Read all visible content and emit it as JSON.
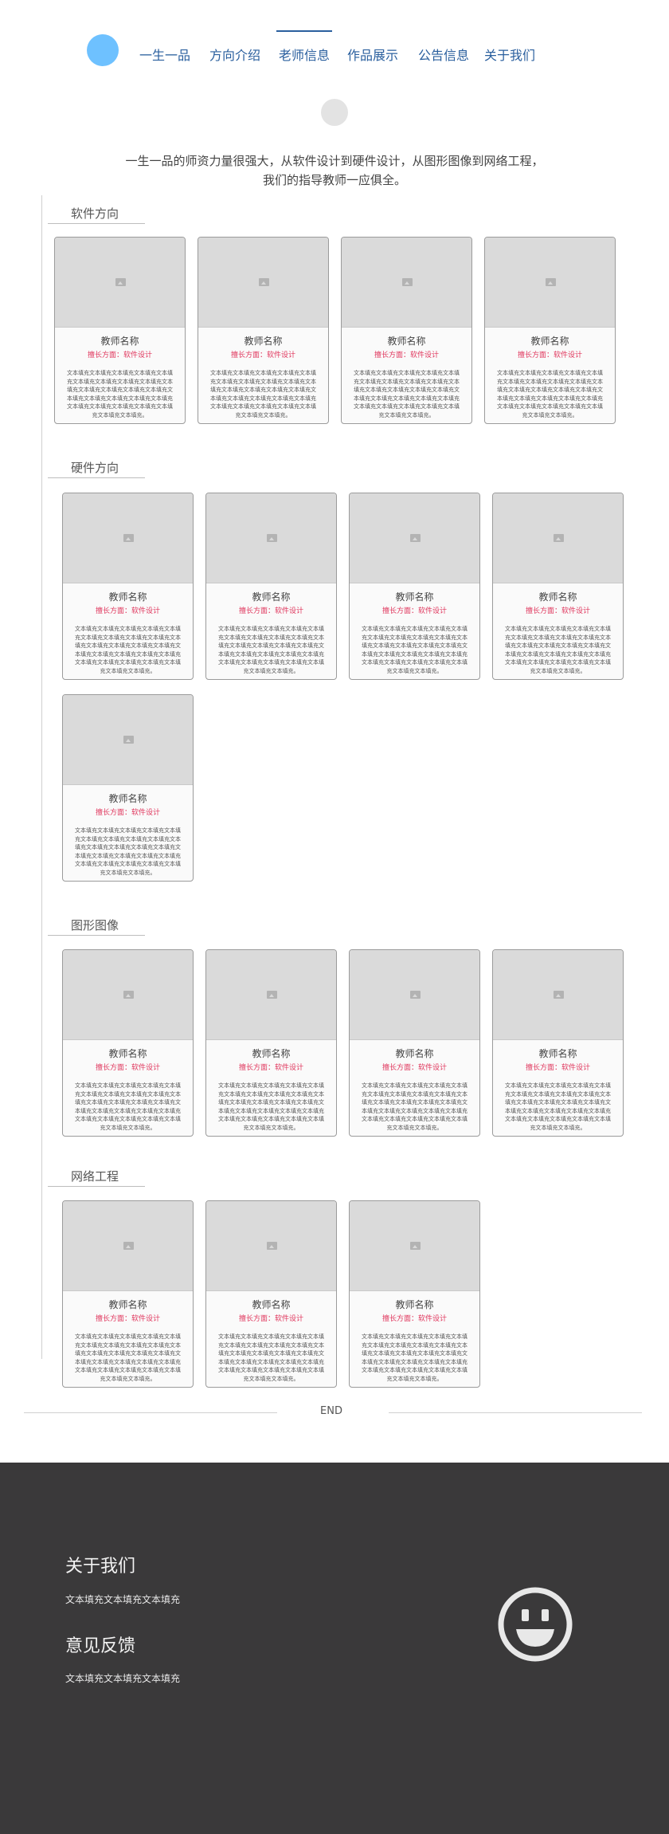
{
  "nav": {
    "items": [
      {
        "label": "一生一品",
        "active": false
      },
      {
        "label": "方向介绍",
        "active": false
      },
      {
        "label": "老师信息",
        "active": true
      },
      {
        "label": "作品展示",
        "active": false
      },
      {
        "label": "公告信息",
        "active": false
      },
      {
        "label": "关于我们",
        "active": false
      }
    ]
  },
  "intro": {
    "line1": "一生一品的师资力量很强大，从软件设计到硬件设计，从图形图像到网络工程，",
    "line2": "我们的指导教师一应俱全。"
  },
  "sections": [
    {
      "title": "软件方向"
    },
    {
      "title": "硬件方向"
    },
    {
      "title": "图形图像"
    },
    {
      "title": "网络工程"
    }
  ],
  "card": {
    "name": "教师名称",
    "specialty": "擅长方面：软件设计",
    "desc": "文本填充文本填充文本填充文本填充文本填充文本填充文本填充文本填充文本填充文本填充文本填充文本填充文本填充文本填充文本填充文本填充文本填充文本填充文本填充文本填充文本填充文本填充文本填充文本填充文本填充文本填充。"
  },
  "end": {
    "label": "END"
  },
  "footer": {
    "about_title": "关于我们",
    "about_text": "文本填充文本填充文本填充",
    "feedback_title": "意见反馈",
    "feedback_text": "文本填充文本填充文本填充"
  },
  "icons": {
    "image_placeholder": "image-placeholder-icon",
    "smiley": "smiley-face-icon"
  },
  "colors": {
    "nav_text": "#2a5f9e",
    "logo": "#6ec1ff",
    "specialty": "#e0355c",
    "footer_bg": "#3a393a"
  }
}
